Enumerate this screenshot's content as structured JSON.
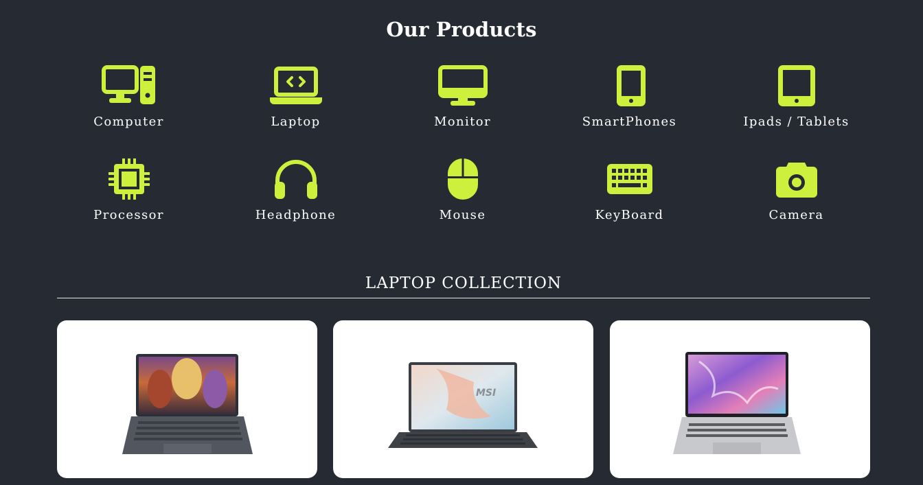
{
  "page": {
    "title": "Our Products"
  },
  "colors": {
    "background": "#262a33",
    "accent": "#cdf03c",
    "card": "#ffffff",
    "text": "#ffffff"
  },
  "categories": [
    {
      "label": "Computer",
      "icon": "desktop-computer-icon"
    },
    {
      "label": "Laptop",
      "icon": "laptop-code-icon"
    },
    {
      "label": "Monitor",
      "icon": "monitor-icon"
    },
    {
      "label": "SmartPhones",
      "icon": "smartphone-icon"
    },
    {
      "label": "Ipads / Tablets",
      "icon": "tablet-icon"
    },
    {
      "label": "Processor",
      "icon": "cpu-chip-icon"
    },
    {
      "label": "Headphone",
      "icon": "headphones-icon"
    },
    {
      "label": "Mouse",
      "icon": "mouse-icon"
    },
    {
      "label": "KeyBoard",
      "icon": "keyboard-icon"
    },
    {
      "label": "Camera",
      "icon": "camera-icon"
    }
  ],
  "collection": {
    "heading": "LAPTOP COLLECTION",
    "products": [
      {
        "image": "laptop-concert-screen-image"
      },
      {
        "image": "msi-laptop-image",
        "screen_text": "MSI"
      },
      {
        "image": "laptop-purple-screen-image"
      }
    ]
  }
}
